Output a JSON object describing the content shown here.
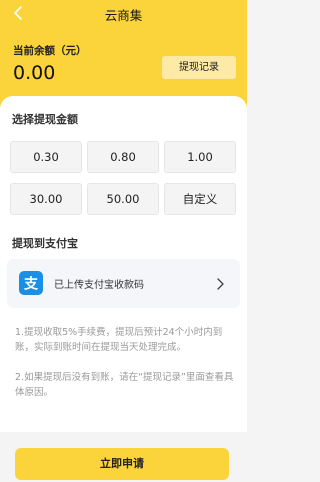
{
  "nav": {
    "title": "云商集",
    "back_icon": "chevron-left-icon"
  },
  "balance": {
    "label": "当前余额（元）",
    "value": "0.00",
    "record_button": "提现记录"
  },
  "amount_section": {
    "title": "选择提现金额",
    "options": [
      "0.30",
      "0.80",
      "1.00",
      "30.00",
      "50.00",
      "自定义"
    ]
  },
  "alipay_section": {
    "title": "提现到支付宝",
    "row_icon": "alipay-icon",
    "row_text": "已上传支付宝收款码",
    "chevron_icon": "chevron-right-icon"
  },
  "notes": [
    "1.提现收取5%手续费，提现后预计24个小时内到账，实际到账时间在提现当天处理完成。",
    "2.如果提现后没有到账，请在“提现记录”里面查看具体原因。"
  ],
  "submit": {
    "label": "立即申请"
  },
  "colors": {
    "brand_yellow": "#fbd33a",
    "record_button_bg": "#fdeaa7",
    "alipay_blue": "#1a8fe6"
  }
}
